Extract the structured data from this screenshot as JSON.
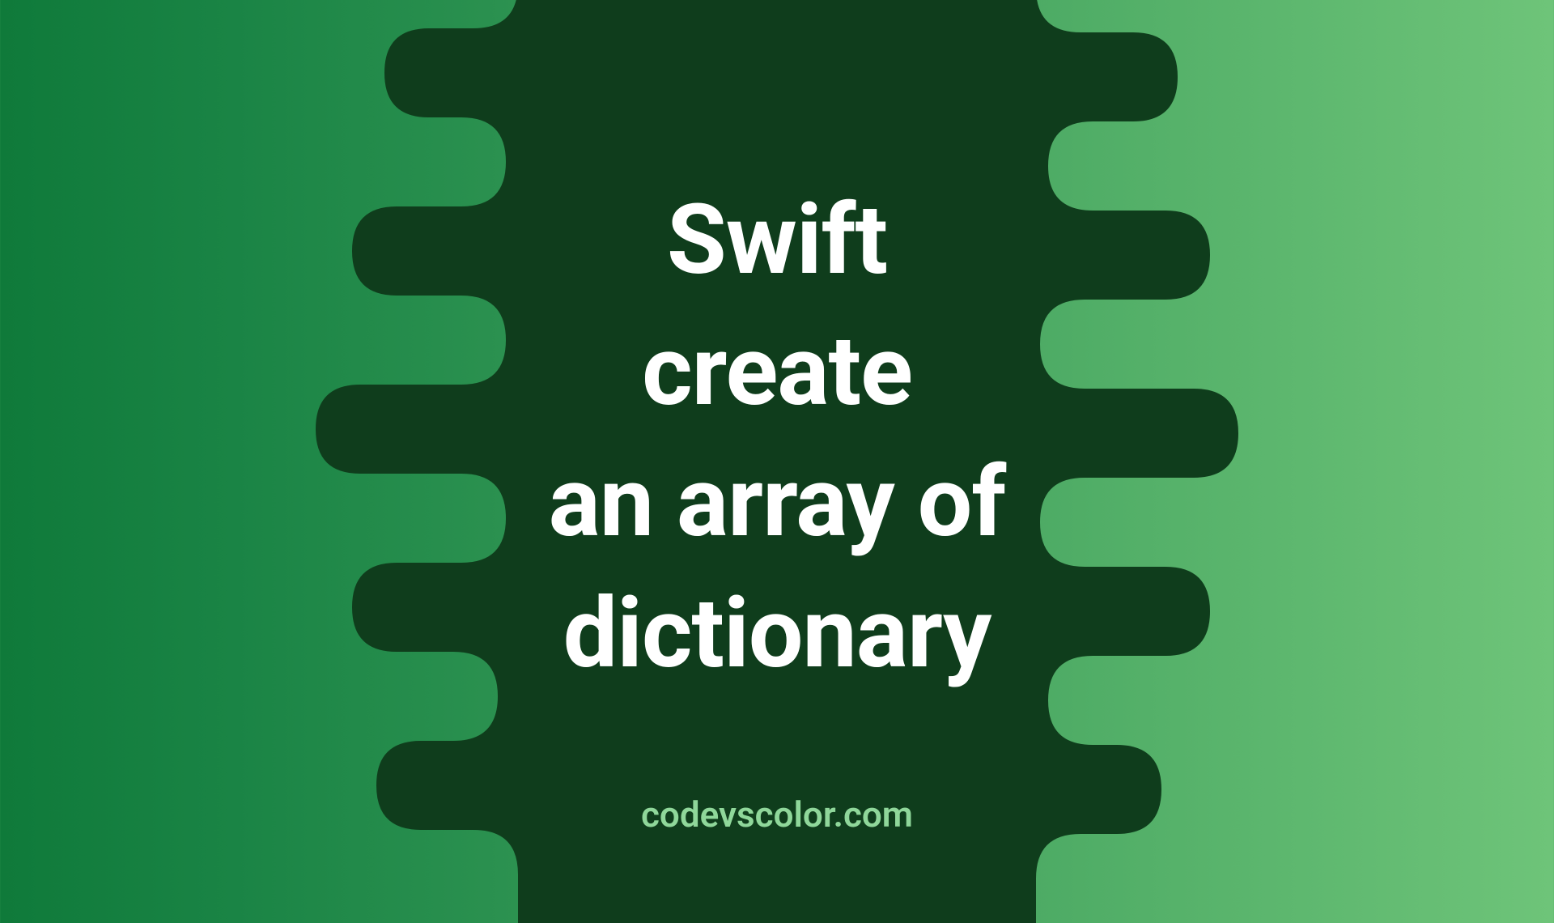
{
  "main": {
    "title": "Swift\ncreate\nan array of\ndictionary"
  },
  "footer": {
    "site": "codevscolor.com"
  },
  "colors": {
    "blob": "#0f3d1c",
    "text": "#ffffff",
    "footer": "#8fd79a"
  }
}
